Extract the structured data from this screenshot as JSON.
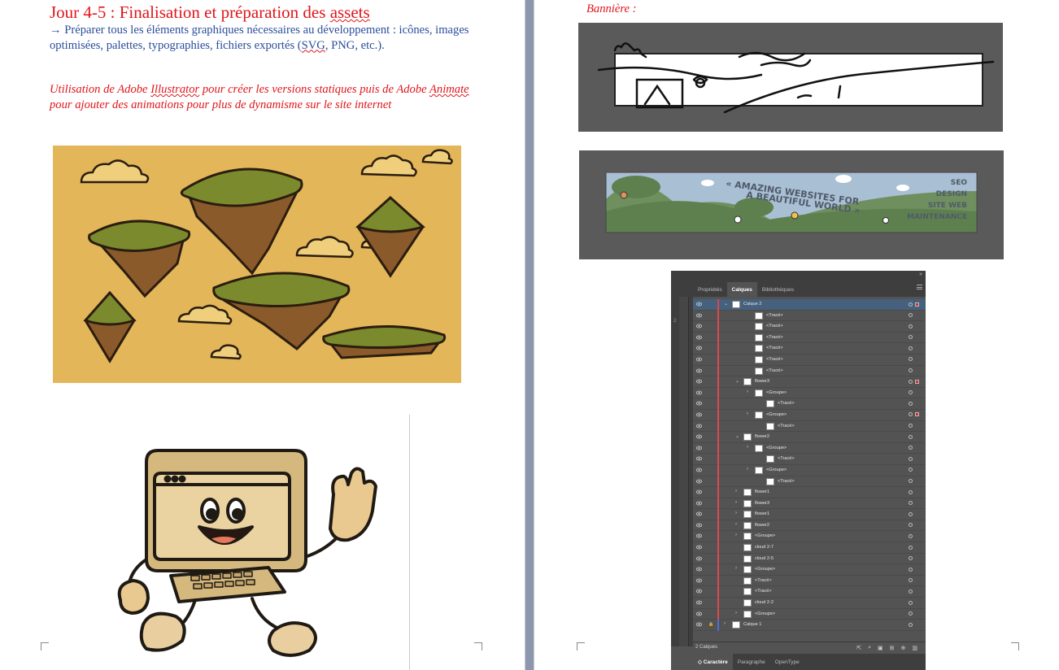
{
  "left_page": {
    "heading": "Jour 4-5 : Finalisation et préparation des assets",
    "body_text": "→ Préparer tous les éléments graphiques nécessaires au développement : icônes, images optimisées, palettes, typographies, fichiers exportés (SVG, PNG, etc.).",
    "note_text": "Utilisation de Adobe Illustrator pour créer les versions statiques puis de Adobe Animate pour ajouter des animations pour plus de dynamisme sur le site internet"
  },
  "right_page": {
    "banner_label": "Bannière :",
    "banner_slogan": "« AMAZING WEBSITES FOR A BEAUTIFUL WORLD »",
    "banner_services": [
      "SEO",
      "DESIGN",
      "SITE WEB",
      "MAINTENANCE"
    ]
  },
  "ai_panel": {
    "tabs": [
      "Propriétés",
      "Calques",
      "Bibliothèques"
    ],
    "active_tab": "Calques",
    "left_strip_number": "2",
    "layers": [
      {
        "name": "Calque 2",
        "indent": 0,
        "twisty": "open",
        "selected": true,
        "sel_box": true
      },
      {
        "name": "<Tracé>",
        "indent": 2,
        "twisty": ""
      },
      {
        "name": "<Tracé>",
        "indent": 2,
        "twisty": ""
      },
      {
        "name": "<Tracé>",
        "indent": 2,
        "twisty": ""
      },
      {
        "name": "<Tracé>",
        "indent": 2,
        "twisty": ""
      },
      {
        "name": "<Tracé>",
        "indent": 2,
        "twisty": ""
      },
      {
        "name": "<Tracé>",
        "indent": 2,
        "twisty": ""
      },
      {
        "name": "flower3",
        "indent": 1,
        "twisty": "open",
        "sel_box": true
      },
      {
        "name": "<Groupe>",
        "indent": 2,
        "twisty": "closed"
      },
      {
        "name": "<Tracé>",
        "indent": 3,
        "twisty": ""
      },
      {
        "name": "<Groupe>",
        "indent": 2,
        "twisty": "closed",
        "sel_box": true
      },
      {
        "name": "<Tracé>",
        "indent": 3,
        "twisty": ""
      },
      {
        "name": "flower2",
        "indent": 1,
        "twisty": "open"
      },
      {
        "name": "<Groupe>",
        "indent": 2,
        "twisty": "closed"
      },
      {
        "name": "<Tracé>",
        "indent": 3,
        "twisty": ""
      },
      {
        "name": "<Groupe>",
        "indent": 2,
        "twisty": "closed"
      },
      {
        "name": "<Tracé>",
        "indent": 3,
        "twisty": ""
      },
      {
        "name": "flower1",
        "indent": 1,
        "twisty": "closed"
      },
      {
        "name": "flower3",
        "indent": 1,
        "twisty": "closed"
      },
      {
        "name": "flower1",
        "indent": 1,
        "twisty": "closed"
      },
      {
        "name": "flower2",
        "indent": 1,
        "twisty": "closed"
      },
      {
        "name": "<Groupe>",
        "indent": 1,
        "twisty": "closed"
      },
      {
        "name": "cloud 2-7",
        "indent": 1,
        "twisty": ""
      },
      {
        "name": "cloud 2-5",
        "indent": 1,
        "twisty": ""
      },
      {
        "name": "<Groupe>",
        "indent": 1,
        "twisty": "closed"
      },
      {
        "name": "<Tracé>",
        "indent": 1,
        "twisty": ""
      },
      {
        "name": "<Tracé>",
        "indent": 1,
        "twisty": ""
      },
      {
        "name": "cloud 2-2",
        "indent": 1,
        "twisty": ""
      },
      {
        "name": "<Groupe>",
        "indent": 1,
        "twisty": "closed"
      },
      {
        "name": "Calque 1",
        "indent": 0,
        "twisty": "closed",
        "locked": true,
        "blue": true
      }
    ],
    "footer_count": "2 Calques",
    "bottom_tabs": [
      "Caractère",
      "Paragraphe",
      "OpenType"
    ],
    "bottom_active": "Caractère"
  }
}
